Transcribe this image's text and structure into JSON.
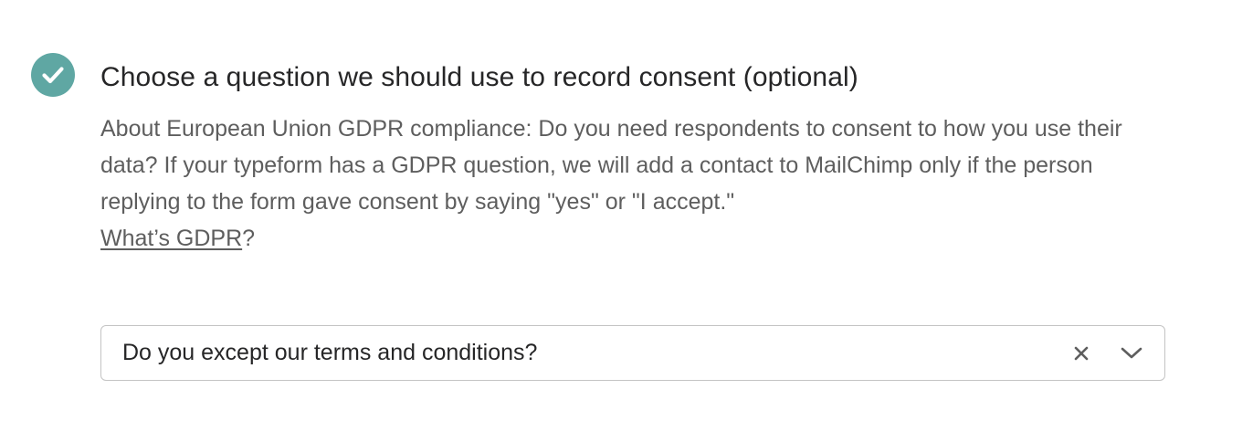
{
  "step": {
    "status": "completed",
    "accent_color": "#5fa7a3",
    "icon": "checkmark-icon",
    "title": "Choose a question we should use to record consent (optional)",
    "description": "About European Union GDPR compliance: Do you need respondents to consent to how you use their data? If your typeform has a GDPR question, we will add a contact to MailChimp only if the person replying to the form gave consent by saying \"yes\" or \"I accept.\"",
    "gdpr_link_label": "What’s GDPR",
    "gdpr_link_suffix": "?"
  },
  "select": {
    "value": "Do you except our terms and conditions?",
    "clear_icon": "close-icon",
    "dropdown_icon": "chevron-down-icon"
  }
}
